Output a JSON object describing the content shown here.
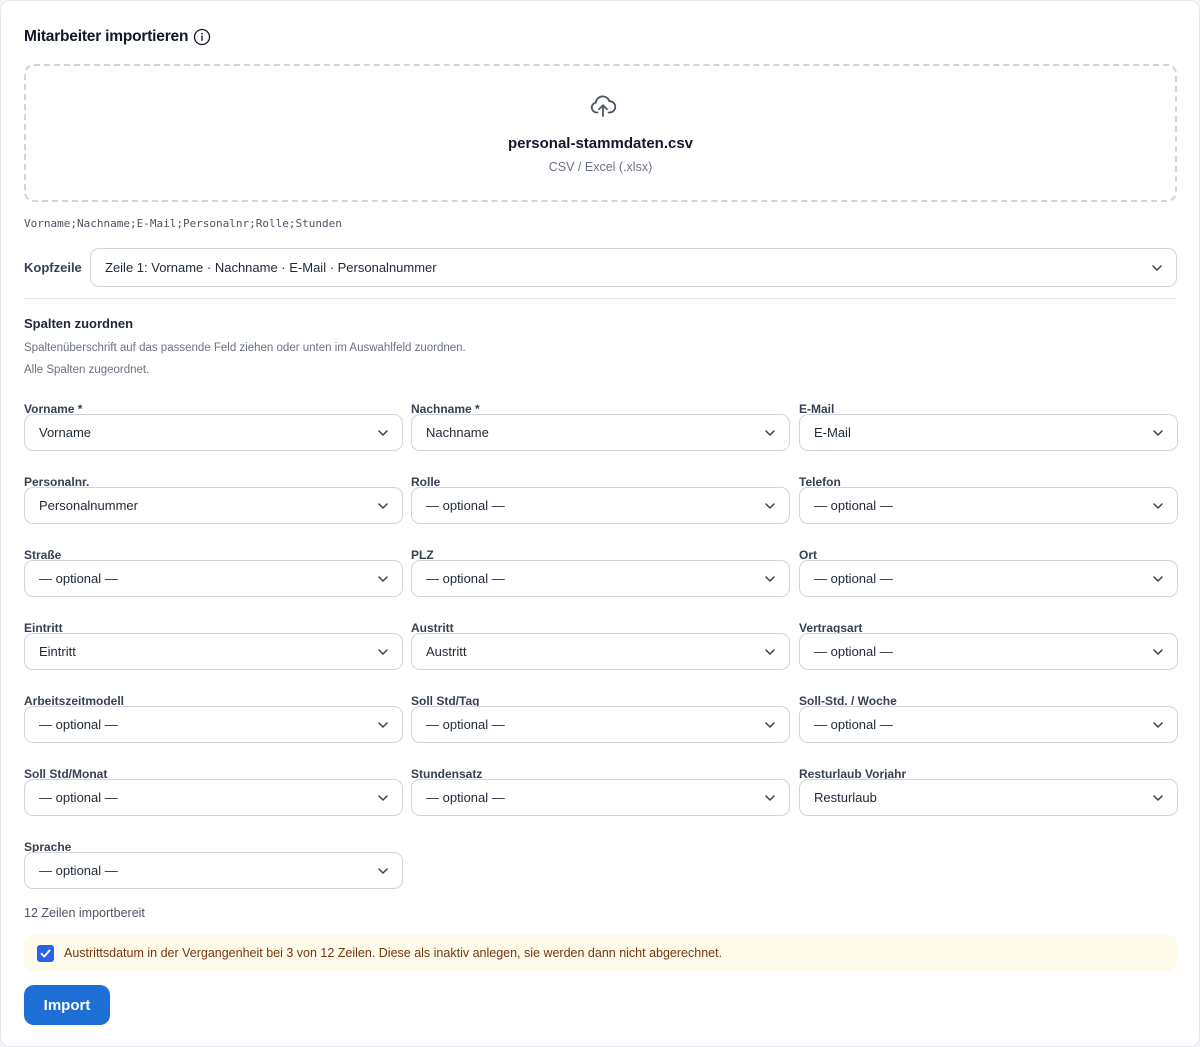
{
  "title": "Mitarbeiter importieren",
  "dropzone": {
    "file_name": "personal-stammdaten.csv",
    "file_types": "CSV / Excel (.xlsx)"
  },
  "header_preview": "Vorname;Nachname;E-Mail;Personalnr;Rolle;Stunden",
  "header_row": {
    "label": "Kopfzeile",
    "value": "Zeile 1: Vorname · Nachname · E-Mail · Personalnummer"
  },
  "mapping": {
    "title": "Spalten zuordnen",
    "help": "Spaltenüberschrift auf das passende Feld ziehen oder unten im Auswahlfeld zuordnen.",
    "status": "Alle Spalten zugeordnet.",
    "fields": [
      {
        "label": "Vorname *",
        "value": "Vorname"
      },
      {
        "label": "Nachname *",
        "value": "Nachname"
      },
      {
        "label": "E-Mail",
        "value": "E-Mail"
      },
      {
        "label": "Personalnr.",
        "value": "Personalnummer"
      },
      {
        "label": "Rolle",
        "value": "— optional —"
      },
      {
        "label": "Telefon",
        "value": "— optional —"
      },
      {
        "label": "Straße",
        "value": "— optional —"
      },
      {
        "label": "PLZ",
        "value": "— optional —"
      },
      {
        "label": "Ort",
        "value": "— optional —"
      },
      {
        "label": "Eintritt",
        "value": "Eintritt"
      },
      {
        "label": "Austritt",
        "value": "Austritt"
      },
      {
        "label": "Vertragsart",
        "value": "— optional —"
      },
      {
        "label": "Arbeitszeitmodell",
        "value": "— optional —"
      },
      {
        "label": "Soll Std/Tag",
        "value": "— optional —"
      },
      {
        "label": "Soll-Std. / Woche",
        "value": "— optional —"
      },
      {
        "label": "Soll Std/Monat",
        "value": "— optional —"
      },
      {
        "label": "Stundensatz",
        "value": "— optional —"
      },
      {
        "label": "Resturlaub Vorjahr",
        "value": "Resturlaub"
      },
      {
        "label": "Sprache",
        "value": "— optional —"
      }
    ]
  },
  "rows_ready": "12 Zeilen importbereit",
  "notice": {
    "checked": true,
    "text": "Austrittsdatum in der Vergangenheit bei 3 von 12 Zeilen. Diese als inaktiv anlegen, sie werden dann nicht abgerechnet."
  },
  "import_button": "Import",
  "colors": {
    "primary": "#1d6fd6",
    "checkbox": "#2563eb",
    "notice_bg": "#fefbeb",
    "notice_text": "#78350f"
  },
  "icons": [
    "info-icon",
    "cloud-upload-icon",
    "chevron-down-icon",
    "checkmark-icon"
  ]
}
